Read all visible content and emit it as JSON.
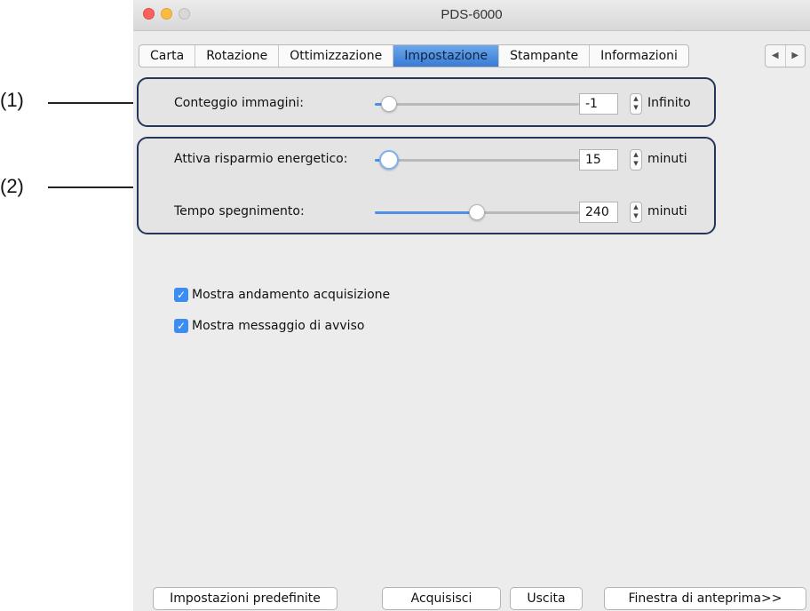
{
  "callouts": [
    "(1)",
    "(2)"
  ],
  "window": {
    "title": "PDS-6000"
  },
  "tabs": [
    "Carta",
    "Rotazione",
    "Ottimizzazione",
    "Impostazione",
    "Stampante",
    "Informazioni"
  ],
  "active_tab": "Impostazione",
  "tab_scroll": {
    "left": "◀",
    "right": "▶"
  },
  "image_count": {
    "label": "Conteggio immagini:",
    "value": "-1",
    "unit": "Infinito",
    "slider_fraction": 0.07
  },
  "power_save": {
    "label": "Attiva risparmio energetico:",
    "value": "15",
    "unit": "minuti",
    "slider_fraction": 0.07
  },
  "shutdown": {
    "label": "Tempo spegnimento:",
    "value": "240",
    "unit": "minuti",
    "slider_fraction": 0.5
  },
  "checkboxes": [
    {
      "label": "Mostra andamento acquisizione",
      "checked": true
    },
    {
      "label": "Mostra messaggio di avviso",
      "checked": true
    }
  ],
  "buttons": {
    "defaults": "Impostazioni predefinite",
    "scan": "Acquisisci",
    "exit": "Uscita",
    "preview": "Finestra di anteprima>>"
  },
  "colors": {
    "accent": "#3b8cf3",
    "group_border": "#26355c"
  },
  "icons": {
    "stepper": "stepper-arrows-icon",
    "checkmark": "checkmark-icon"
  }
}
